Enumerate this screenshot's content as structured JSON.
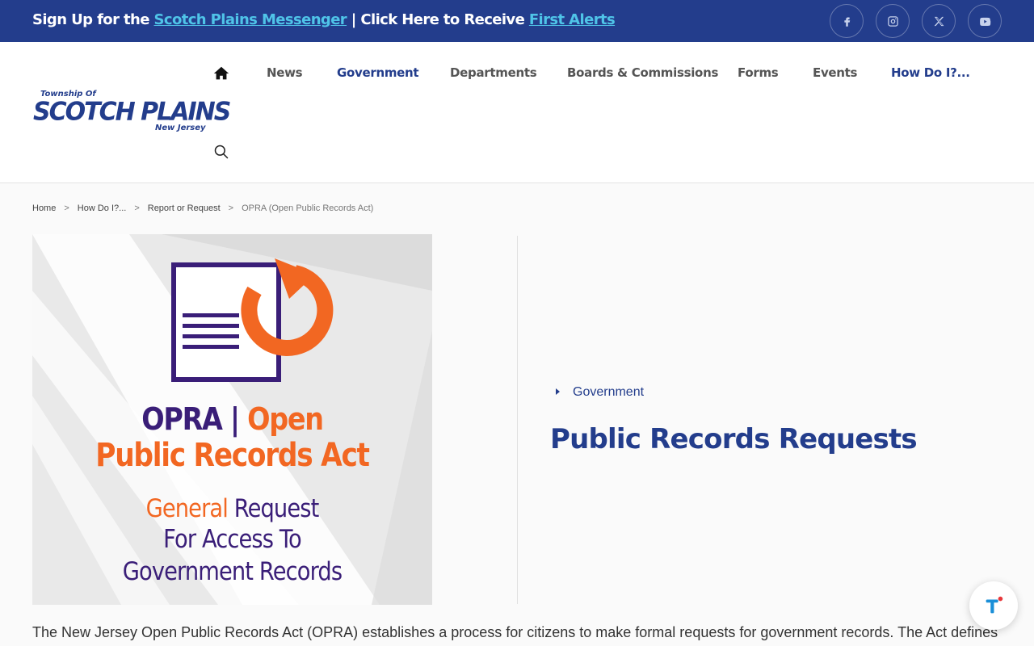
{
  "topbar": {
    "text1": "Sign Up for the ",
    "link1": "Scotch Plains Messenger",
    "text2": " |  Click Here to Receive ",
    "link2": "First Alerts",
    "social": [
      "facebook-icon",
      "instagram-icon",
      "x-icon",
      "youtube-icon"
    ]
  },
  "logo": {
    "top": "Township Of",
    "main": "SCOTCH PLAINS",
    "bottom": "New Jersey"
  },
  "nav": {
    "items": [
      {
        "label": "News"
      },
      {
        "label": "Government"
      },
      {
        "label": "Departments"
      },
      {
        "label": "Boards & Commissions"
      },
      {
        "label": "Forms"
      },
      {
        "label": "Events"
      },
      {
        "label": "How Do I?..."
      }
    ]
  },
  "breadcrumb": {
    "items": [
      "Home",
      "How Do I?...",
      "Report or Request",
      "OPRA (Open Public Records Act)"
    ]
  },
  "hero": {
    "line1_a": "OPRA | ",
    "line1_b": "Open",
    "line2": "Public Records Act",
    "sub1_a": "General",
    "sub1_b": " Request",
    "sub2": "For Access To",
    "sub3": "Government Records"
  },
  "main": {
    "category": "Government",
    "title": "Public Records Requests",
    "body": "The New Jersey Open Public Records Act (OPRA) establishes a process for citizens to make formal requests for government records. The Act defines"
  },
  "colors": {
    "brand_blue": "#233d8c",
    "link_cyan": "#4fc4e8",
    "opra_orange": "#f26722",
    "opra_purple": "#3a1e78"
  }
}
